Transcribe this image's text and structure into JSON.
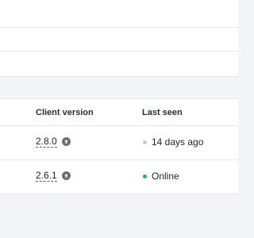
{
  "table": {
    "columns": {
      "client_version": "Client version",
      "last_seen": "Last seen"
    },
    "rows": [
      {
        "client_version": "2.8.0",
        "upgrade_icon": "arrow-up-circle-icon",
        "last_seen": "14 days ago",
        "status_color": "#c9cbd0"
      },
      {
        "client_version": "2.6.1",
        "upgrade_icon": "arrow-up-circle-icon",
        "last_seen": "Online",
        "status_color": "#1fb25a"
      }
    ]
  },
  "colors": {
    "background": "#f4f5f8",
    "surface": "#ffffff",
    "divider": "#e3e5ea",
    "online": "#1fb25a",
    "offline": "#c9cbd0",
    "icon": "#6b6f76"
  }
}
